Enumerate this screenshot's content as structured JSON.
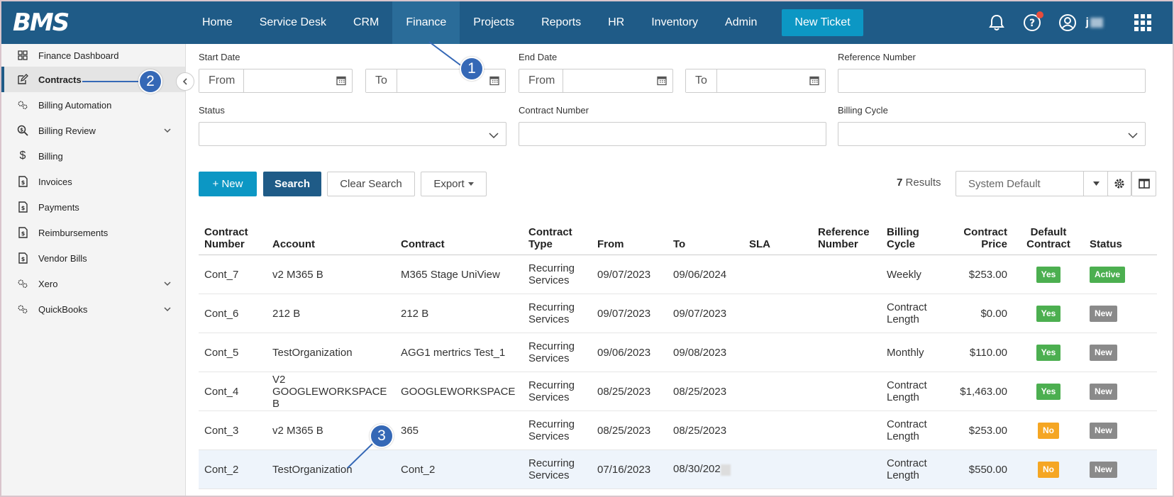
{
  "app": {
    "logo": "BMS",
    "user_name": "j"
  },
  "nav": {
    "items": [
      "Home",
      "Service Desk",
      "CRM",
      "Finance",
      "Projects",
      "Reports",
      "HR",
      "Inventory",
      "Admin"
    ],
    "active": "Finance",
    "new_ticket": "New Ticket"
  },
  "sidebar": {
    "items": [
      {
        "label": "Finance Dashboard",
        "icon": "dashboard-icon"
      },
      {
        "label": "Contracts",
        "icon": "contract-edit-icon",
        "active": true
      },
      {
        "label": "Billing Automation",
        "icon": "gears-icon"
      },
      {
        "label": "Billing Review",
        "icon": "search-dollar-icon",
        "expandable": true
      },
      {
        "label": "Billing",
        "icon": "dollar-icon"
      },
      {
        "label": "Invoices",
        "icon": "invoice-icon"
      },
      {
        "label": "Payments",
        "icon": "invoice-icon"
      },
      {
        "label": "Reimbursements",
        "icon": "invoice-icon"
      },
      {
        "label": "Vendor Bills",
        "icon": "invoice-icon"
      },
      {
        "label": "Xero",
        "icon": "gears-icon",
        "expandable": true
      },
      {
        "label": "QuickBooks",
        "icon": "gears-icon",
        "expandable": true
      }
    ]
  },
  "filters": {
    "start_date_label": "Start Date",
    "end_date_label": "End Date",
    "reference_number_label": "Reference Number",
    "status_label": "Status",
    "contract_number_label": "Contract Number",
    "billing_cycle_label": "Billing Cycle",
    "from_label": "From",
    "to_label": "To"
  },
  "toolbar": {
    "new_label": "+ New",
    "search_label": "Search",
    "clear_label": "Clear Search",
    "export_label": "Export",
    "results_count": "7",
    "results_label": "Results",
    "view_select": "System Default"
  },
  "table": {
    "headers": [
      "Contract Number",
      "Account",
      "Contract",
      "Contract Type",
      "From",
      "To",
      "SLA",
      "Reference Number",
      "Billing Cycle",
      "Contract Price",
      "Default Contract",
      "Status"
    ],
    "rows": [
      {
        "number": "Cont_7",
        "account": "v2 M365 B",
        "contract": "M365 Stage UniView",
        "type": "Recurring Services",
        "from": "09/07/2023",
        "to": "09/06/2024",
        "sla": "",
        "ref": "",
        "cycle": "Weekly",
        "price": "$253.00",
        "default": "Yes",
        "status": "Active"
      },
      {
        "number": "Cont_6",
        "account": "212 B",
        "contract": "212 B",
        "type": "Recurring Services",
        "from": "09/07/2023",
        "to": "09/07/2023",
        "sla": "",
        "ref": "",
        "cycle": "Contract Length",
        "price": "$0.00",
        "default": "Yes",
        "status": "New"
      },
      {
        "number": "Cont_5",
        "account": "TestOrganization",
        "contract": "AGG1 mertrics Test_1",
        "type": "Recurring Services",
        "from": "09/06/2023",
        "to": "09/08/2023",
        "sla": "",
        "ref": "",
        "cycle": "Monthly",
        "price": "$110.00",
        "default": "Yes",
        "status": "New"
      },
      {
        "number": "Cont_4",
        "account": "V2 GOOGLEWORKSPACE B",
        "contract": "GOOGLEWORKSPACE",
        "type": "Recurring Services",
        "from": "08/25/2023",
        "to": "08/25/2023",
        "sla": "",
        "ref": "",
        "cycle": "Contract Length",
        "price": "$1,463.00",
        "default": "Yes",
        "status": "New"
      },
      {
        "number": "Cont_3",
        "account": "v2 M365 B",
        "contract": "365",
        "type": "Recurring Services",
        "from": "08/25/2023",
        "to": "08/25/2023",
        "sla": "",
        "ref": "",
        "cycle": "Contract Length",
        "price": "$253.00",
        "default": "No",
        "status": "New"
      },
      {
        "number": "Cont_2",
        "account": "TestOrganization",
        "contract": "Cont_2",
        "type": "Recurring Services",
        "from": "07/16/2023",
        "to": "08/30/202",
        "sla": "",
        "ref": "",
        "cycle": "Contract Length",
        "price": "$550.00",
        "default": "No",
        "status": "New"
      }
    ]
  },
  "callouts": [
    "1",
    "2",
    "3"
  ],
  "colors": {
    "primary": "#1f5b87",
    "accent": "#0c97c4",
    "callout": "#3568b6",
    "success": "#4caf50",
    "warning": "#f5a623",
    "muted": "#8a8a8a"
  }
}
